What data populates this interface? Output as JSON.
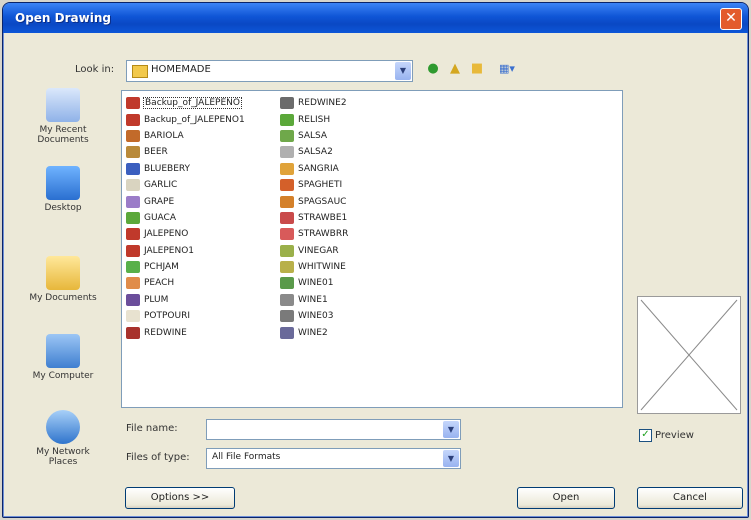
{
  "window": {
    "title": "Open Drawing",
    "close_glyph": "✕"
  },
  "look_in": {
    "label": "Look in:",
    "value": "HOMEMADE"
  },
  "toolbar": {
    "back_icon": "back-arrow-icon",
    "up_icon": "up-folder-icon",
    "new_folder_icon": "new-folder-icon",
    "views_icon": "views-menu-icon"
  },
  "places": [
    {
      "label_lines": [
        "My Recent",
        "Documents"
      ],
      "icon": "recent-documents-icon"
    },
    {
      "label_lines": [
        "Desktop"
      ],
      "icon": "desktop-icon"
    },
    {
      "label_lines": [
        "My Documents"
      ],
      "icon": "my-documents-icon"
    },
    {
      "label_lines": [
        "My Computer"
      ],
      "icon": "my-computer-icon"
    },
    {
      "label_lines": [
        "My Network",
        "Places"
      ],
      "icon": "network-places-icon"
    }
  ],
  "files_col1": [
    {
      "name": "Backup_of_JALEPENO",
      "color": "#c0392b",
      "selected": true
    },
    {
      "name": "Backup_of_JALEPENO1",
      "color": "#c0392b"
    },
    {
      "name": "BARIOLA",
      "color": "#c26a2a"
    },
    {
      "name": "BEER",
      "color": "#b98a3a"
    },
    {
      "name": "BLUEBERY",
      "color": "#3b5fbf"
    },
    {
      "name": "GARLIC",
      "color": "#d9d4c0"
    },
    {
      "name": "GRAPE",
      "color": "#9b7cc8"
    },
    {
      "name": "GUACA",
      "color": "#5ba83a"
    },
    {
      "name": "JALEPENO",
      "color": "#c0392b"
    },
    {
      "name": "JALEPENO1",
      "color": "#c0392b"
    },
    {
      "name": "PCHJAM",
      "color": "#58b04a"
    },
    {
      "name": "PEACH",
      "color": "#e08c4a"
    },
    {
      "name": "PLUM",
      "color": "#6b4e9b"
    },
    {
      "name": "POTPOURI",
      "color": "#e8e2d0"
    },
    {
      "name": "REDWINE",
      "color": "#a8322c"
    }
  ],
  "files_col2": [
    {
      "name": "REDWINE2",
      "color": "#6b6b6b"
    },
    {
      "name": "RELISH",
      "color": "#5ba83a"
    },
    {
      "name": "SALSA",
      "color": "#6fa84a"
    },
    {
      "name": "SALSA2",
      "color": "#b0b0b0"
    },
    {
      "name": "SANGRIA",
      "color": "#e0a33a"
    },
    {
      "name": "SPAGHETI",
      "color": "#d4602a"
    },
    {
      "name": "SPAGSAUC",
      "color": "#d4802a"
    },
    {
      "name": "STRAWBE1",
      "color": "#c94a4a"
    },
    {
      "name": "STRAWBRR",
      "color": "#d85a5a"
    },
    {
      "name": "VINEGAR",
      "color": "#9ab04a"
    },
    {
      "name": "WHITWINE",
      "color": "#b8b04a"
    },
    {
      "name": "WINE01",
      "color": "#5a9a4a"
    },
    {
      "name": "WINE1",
      "color": "#8a8a8a"
    },
    {
      "name": "WINE03",
      "color": "#7a7a7a"
    },
    {
      "name": "WINE2",
      "color": "#6a6a9a"
    }
  ],
  "file_name": {
    "label": "File name:",
    "value": ""
  },
  "files_of_type": {
    "label": "Files of type:",
    "value": "All File Formats"
  },
  "preview": {
    "label": "Preview",
    "checked": true
  },
  "buttons": {
    "options": "Options >>",
    "open": "Open",
    "cancel": "Cancel"
  }
}
